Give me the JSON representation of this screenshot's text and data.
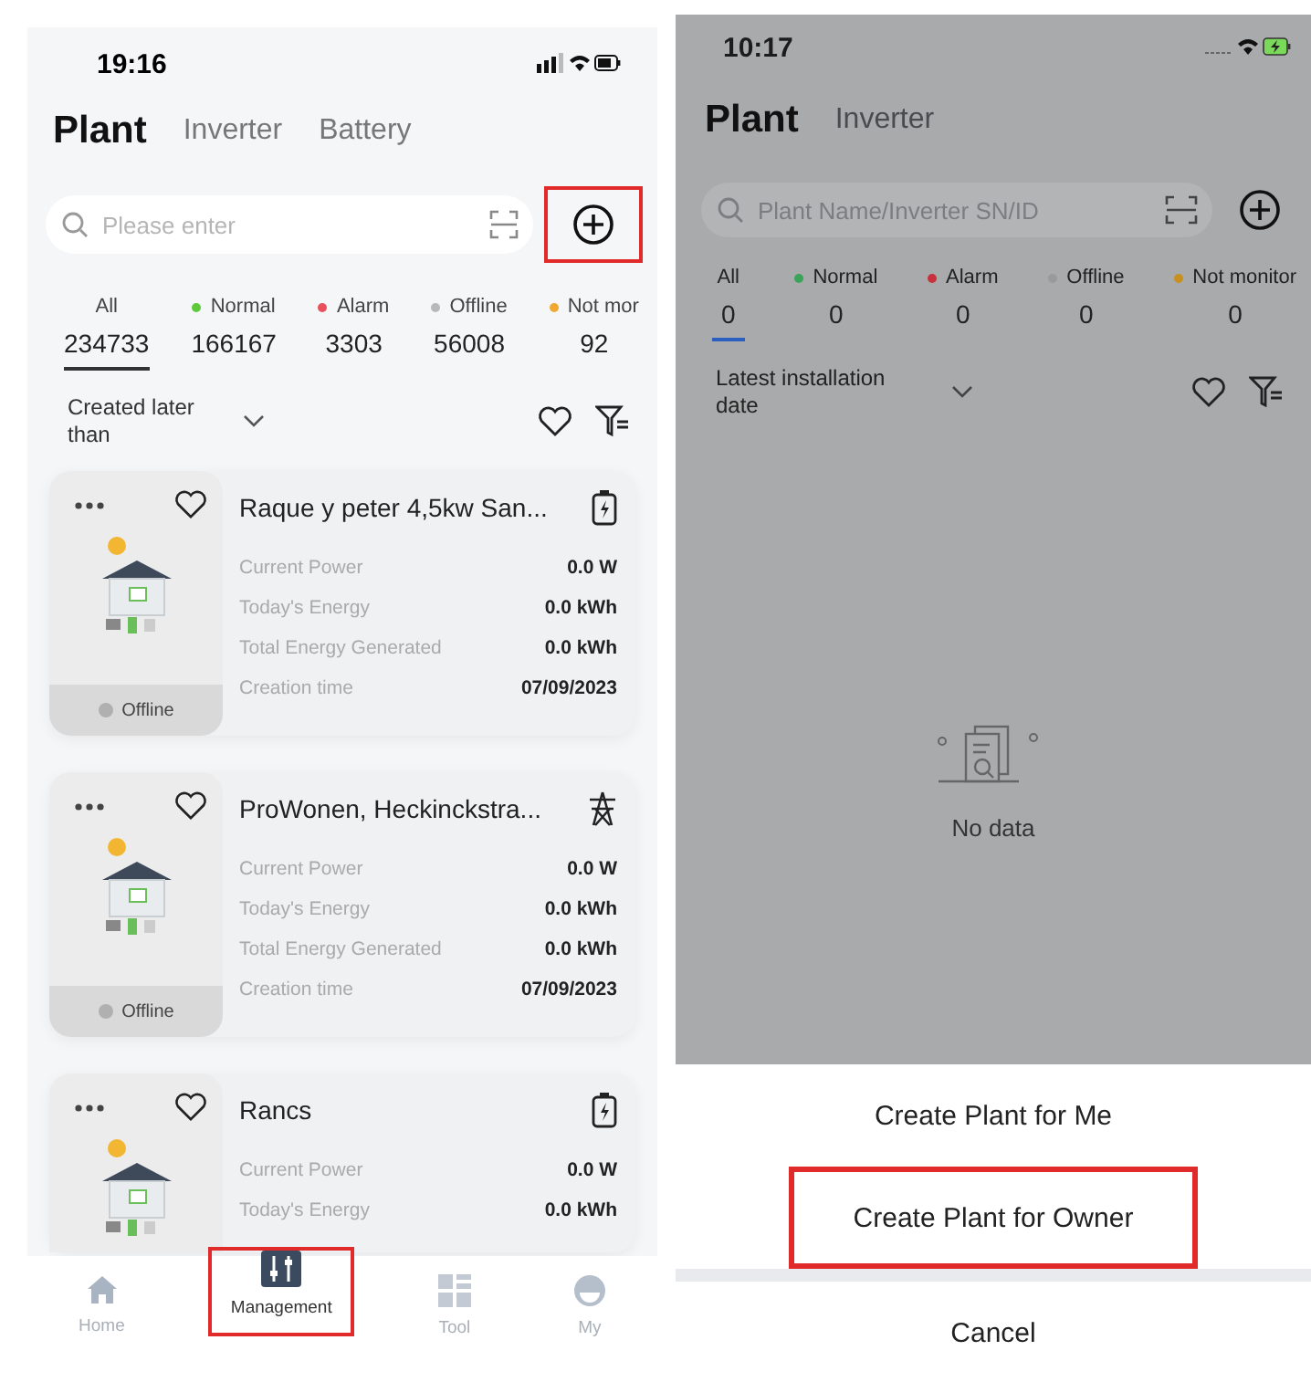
{
  "left_screen": {
    "status_bar": {
      "time": "19:16"
    },
    "tabs": [
      {
        "label": "Plant",
        "selected": true
      },
      {
        "label": "Inverter",
        "selected": false
      },
      {
        "label": "Battery",
        "selected": false
      }
    ],
    "search": {
      "placeholder": "Please enter"
    },
    "add_button": {
      "highlighted": true
    },
    "status_filters": [
      {
        "label": "All",
        "count": "234733",
        "selected": true
      },
      {
        "label": "Normal",
        "count": "166167",
        "color": "#5cc83a",
        "selected": false
      },
      {
        "label": "Alarm",
        "count": "3303",
        "color": "#e8505b",
        "selected": false
      },
      {
        "label": "Offline",
        "count": "56008",
        "color": "#b8b8b8",
        "selected": false
      },
      {
        "label": "Not mor",
        "count": "92",
        "color": "#f0a830",
        "selected": false
      }
    ],
    "sort": {
      "label": "Created later than"
    },
    "plants": [
      {
        "name": "Raque y peter 4,5kw San...",
        "kind": "battery",
        "status": "Offline",
        "metrics": [
          {
            "label": "Current Power",
            "value": "0.0 W"
          },
          {
            "label": "Today's Energy",
            "value": "0.0 kWh"
          },
          {
            "label": "Total Energy Generated",
            "value": "0.0 kWh"
          },
          {
            "label": "Creation time",
            "value": "07/09/2023"
          }
        ]
      },
      {
        "name": "ProWonen, Heckinckstra...",
        "kind": "grid",
        "status": "Offline",
        "metrics": [
          {
            "label": "Current Power",
            "value": "0.0 W"
          },
          {
            "label": "Today's Energy",
            "value": "0.0 kWh"
          },
          {
            "label": "Total Energy Generated",
            "value": "0.0 kWh"
          },
          {
            "label": "Creation time",
            "value": "07/09/2023"
          }
        ]
      },
      {
        "name": "Rancs",
        "kind": "battery",
        "metrics": [
          {
            "label": "Current Power",
            "value": "0.0 W"
          },
          {
            "label": "Today's Energy",
            "value": "0.0 kWh"
          }
        ]
      }
    ],
    "bottom_nav": [
      {
        "label": "Home",
        "selected": false,
        "highlighted": false
      },
      {
        "label": "Management",
        "selected": true,
        "highlighted": true
      },
      {
        "label": "Tool",
        "selected": false,
        "highlighted": false
      },
      {
        "label": "My",
        "selected": false,
        "highlighted": false
      }
    ]
  },
  "right_screen": {
    "status_bar": {
      "time": "10:17"
    },
    "tabs": [
      {
        "label": "Plant",
        "selected": true
      },
      {
        "label": "Inverter",
        "selected": false
      }
    ],
    "search": {
      "placeholder": "Plant Name/Inverter SN/ID"
    },
    "status_filters": [
      {
        "label": "All",
        "count": "0",
        "selected": true
      },
      {
        "label": "Normal",
        "count": "0",
        "color": "#3aa45a",
        "selected": false
      },
      {
        "label": "Alarm",
        "count": "0",
        "color": "#c8323c",
        "selected": false
      },
      {
        "label": "Offline",
        "count": "0",
        "color": "#9a9a9a",
        "selected": false
      },
      {
        "label": "Not monitor",
        "count": "0",
        "color": "#c8901e",
        "selected": false
      }
    ],
    "sort": {
      "label": "Latest installation date"
    },
    "empty": {
      "text": "No data"
    },
    "action_sheet": {
      "options": [
        {
          "label": "Create Plant for Me",
          "highlighted": false
        },
        {
          "label": "Create Plant for Owner",
          "highlighted": true
        }
      ],
      "cancel": "Cancel"
    }
  }
}
